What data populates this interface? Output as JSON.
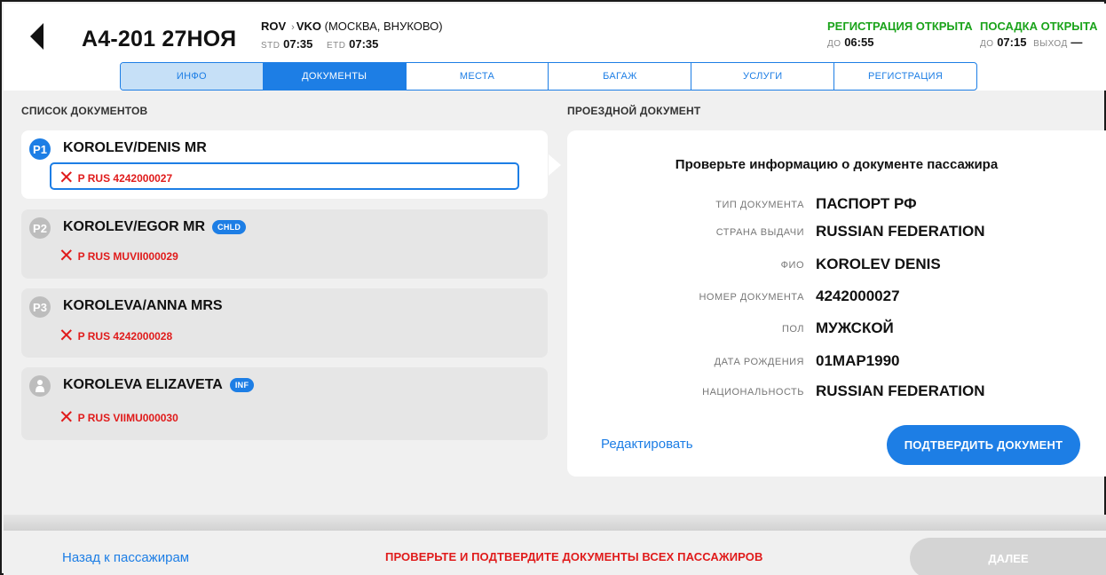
{
  "header": {
    "flight": "А4-201 27НОЯ",
    "route_from": "ROV",
    "route_to": "VKO",
    "route_city": "(МОСКВА, ВНУКОВО)",
    "std_label": "STD",
    "std_value": "07:35",
    "etd_label": "ETD",
    "etd_value": "07:35",
    "checkin_status": "РЕГИСТРАЦИЯ ОТКРЫТА",
    "checkin_until_label": "ДО",
    "checkin_until": "06:55",
    "boarding_status": "ПОСАДКА ОТКРЫТА",
    "boarding_until_label": "ДО",
    "boarding_until": "07:15",
    "gate_label": "ВЫХОД",
    "gate_value": "—",
    "status_color": "#1aa31a"
  },
  "tabs": [
    {
      "label": "ИНФО"
    },
    {
      "label": "ДОКУМЕНТЫ"
    },
    {
      "label": "МЕСТА"
    },
    {
      "label": "БАГАЖ"
    },
    {
      "label": "УСЛУГИ"
    },
    {
      "label": "РЕГИСТРАЦИЯ"
    }
  ],
  "left": {
    "title": "СПИСОК ДОКУМЕНТОВ",
    "passengers": [
      {
        "badge": "P1",
        "name": "KOROLEV/DENIS MR",
        "tag": "",
        "doc": "P RUS 4242000027"
      },
      {
        "badge": "P2",
        "name": "KOROLEV/EGOR MR",
        "tag": "CHLD",
        "doc": "P RUS MUVII000029"
      },
      {
        "badge": "P3",
        "name": "KOROLEVA/ANNA MRS",
        "tag": "",
        "doc": "P RUS 4242000028"
      },
      {
        "badge": "infant-icon",
        "name": "KOROLEVA ELIZAVETA",
        "tag": "INF",
        "doc": "P RUS VIIMU000030"
      }
    ]
  },
  "right": {
    "title": "ПРОЕЗДНОЙ ДОКУМЕНТ",
    "heading": "Проверьте информацию о документе пассажира",
    "fields": [
      {
        "label": "ТИП ДОКУМЕНТА",
        "value": "ПАСПОРТ РФ"
      },
      {
        "label": "СТРАНА ВЫДАЧИ",
        "value": "RUSSIAN FEDERATION"
      },
      {
        "label": "ФИО",
        "value": "KOROLEV DENIS"
      },
      {
        "label": "НОМЕР ДОКУМЕНТА",
        "value": "4242000027"
      },
      {
        "label": "ПОЛ",
        "value": "МУЖСКОЙ"
      },
      {
        "label": "ДАТА РОЖДЕНИЯ",
        "value": "01МАР1990"
      },
      {
        "label": "НАЦИОНАЛЬНОСТЬ",
        "value": "RUSSIAN FEDERATION"
      }
    ],
    "edit_label": "Редактировать",
    "confirm_label": "ПОДТВЕРДИТЬ ДОКУМЕНТ"
  },
  "footer": {
    "back_label": "Назад к пассажирам",
    "warning": "ПРОВЕРЬТЕ И ПОДТВЕРДИТЕ ДОКУМЕНТЫ ВСЕХ ПАССАЖИРОВ",
    "next_label": "ДАЛЕЕ"
  },
  "colors": {
    "accent": "#1d7ee5",
    "error": "#e01b1b",
    "ok": "#1aa31a"
  }
}
